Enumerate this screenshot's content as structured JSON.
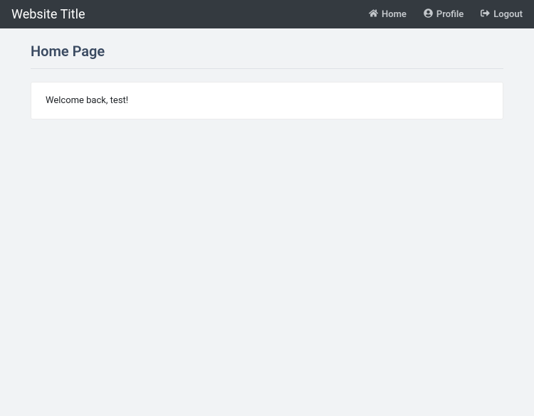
{
  "navbar": {
    "brand": "Website Title",
    "links": {
      "home": "Home",
      "profile": "Profile",
      "logout": "Logout"
    }
  },
  "page": {
    "title": "Home Page"
  },
  "card": {
    "message": "Welcome back, test!"
  }
}
